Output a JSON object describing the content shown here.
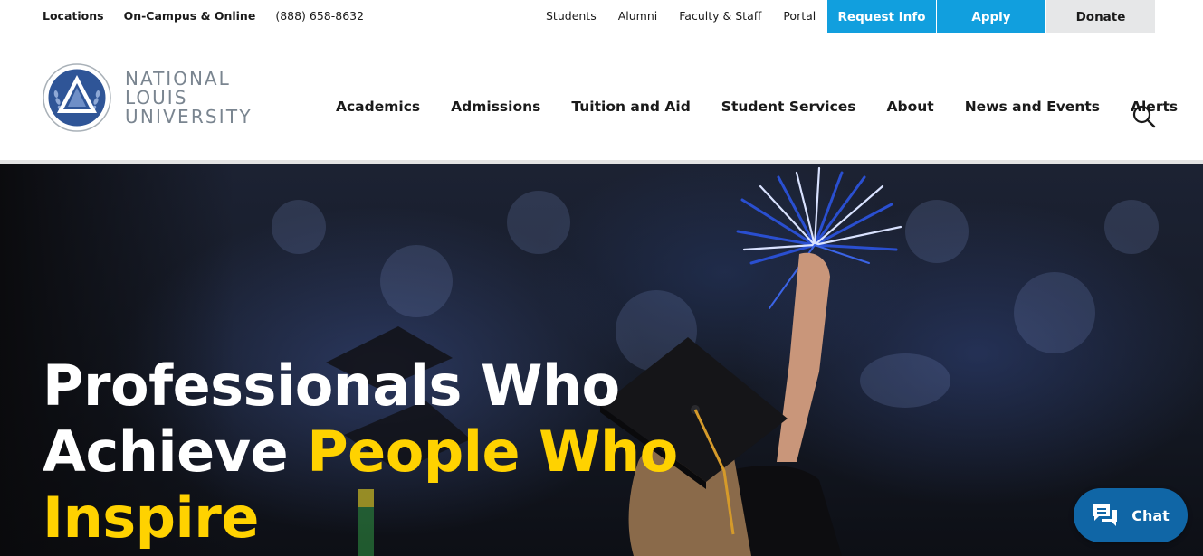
{
  "utility": {
    "left_links": [
      {
        "label": "Locations"
      },
      {
        "label": "On-Campus & Online"
      },
      {
        "label": "(888) 658-8632"
      }
    ],
    "right_links": [
      {
        "label": "Students"
      },
      {
        "label": "Alumni"
      },
      {
        "label": "Faculty & Staff"
      },
      {
        "label": "Portal"
      }
    ],
    "request_info": "Request Info",
    "apply": "Apply",
    "donate": "Donate"
  },
  "logo": {
    "line1": "NATIONAL",
    "line2": "LOUIS",
    "line3": "UNIVERSITY"
  },
  "nav": {
    "items": [
      {
        "label": "Academics"
      },
      {
        "label": "Admissions"
      },
      {
        "label": "Tuition and Aid"
      },
      {
        "label": "Student Services"
      },
      {
        "label": "About"
      },
      {
        "label": "News and Events"
      },
      {
        "label": "Alerts"
      }
    ],
    "search_icon": "search-icon"
  },
  "hero": {
    "line1": "Professionals Who",
    "line2_white": "Achieve ",
    "line2_gold": "People Who",
    "line3_gold": "Inspire"
  },
  "chat": {
    "label": "Chat",
    "icon": "chat-bubbles-icon"
  },
  "colors": {
    "accent_blue": "#119fde",
    "chat_blue": "#1066a6",
    "headline_gold": "#ffd200",
    "donate_gray": "#e6e7e8"
  }
}
